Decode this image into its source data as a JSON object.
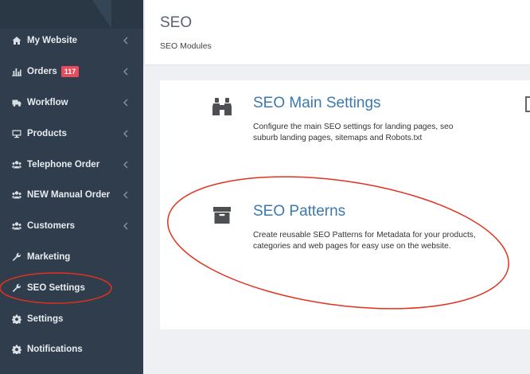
{
  "sidebar": {
    "items": [
      {
        "label": "My Website",
        "icon": "home-icon",
        "chevron": true
      },
      {
        "label": "Orders",
        "icon": "bar-chart-icon",
        "chevron": true,
        "badge": "117"
      },
      {
        "label": "Workflow",
        "icon": "truck-icon",
        "chevron": true
      },
      {
        "label": "Products",
        "icon": "monitor-icon",
        "chevron": true
      },
      {
        "label": "Telephone Order",
        "icon": "users-icon",
        "chevron": true
      },
      {
        "label": "NEW Manual Order",
        "icon": "users-icon",
        "chevron": true
      },
      {
        "label": "Customers",
        "icon": "users-icon",
        "chevron": true
      },
      {
        "label": "Marketing",
        "icon": "wrench-icon",
        "chevron": false
      },
      {
        "label": "SEO Settings",
        "icon": "wrench-icon",
        "chevron": false
      },
      {
        "label": "Settings",
        "icon": "gear-icon",
        "chevron": false
      },
      {
        "label": "Notifications",
        "icon": "gear-icon",
        "chevron": false
      }
    ]
  },
  "header": {
    "title": "SEO",
    "subtitle": "SEO Modules"
  },
  "modules": [
    {
      "title": "SEO Main Settings",
      "description": "Configure the main SEO settings for landing pages, seo suburb landing pages, sitemaps and Robots.txt",
      "icon": "binoculars-icon"
    },
    {
      "title": "SEO Patterns",
      "description": "Create reusable SEO Patterns for Metadata for your products, categories and web pages for easy use on the website.",
      "icon": "archive-box-icon"
    }
  ],
  "colors": {
    "sidebar_bg": "#2f3d4c",
    "badge": "#e94b5b",
    "link": "#3b79b0",
    "annotation": "#e0321e"
  }
}
